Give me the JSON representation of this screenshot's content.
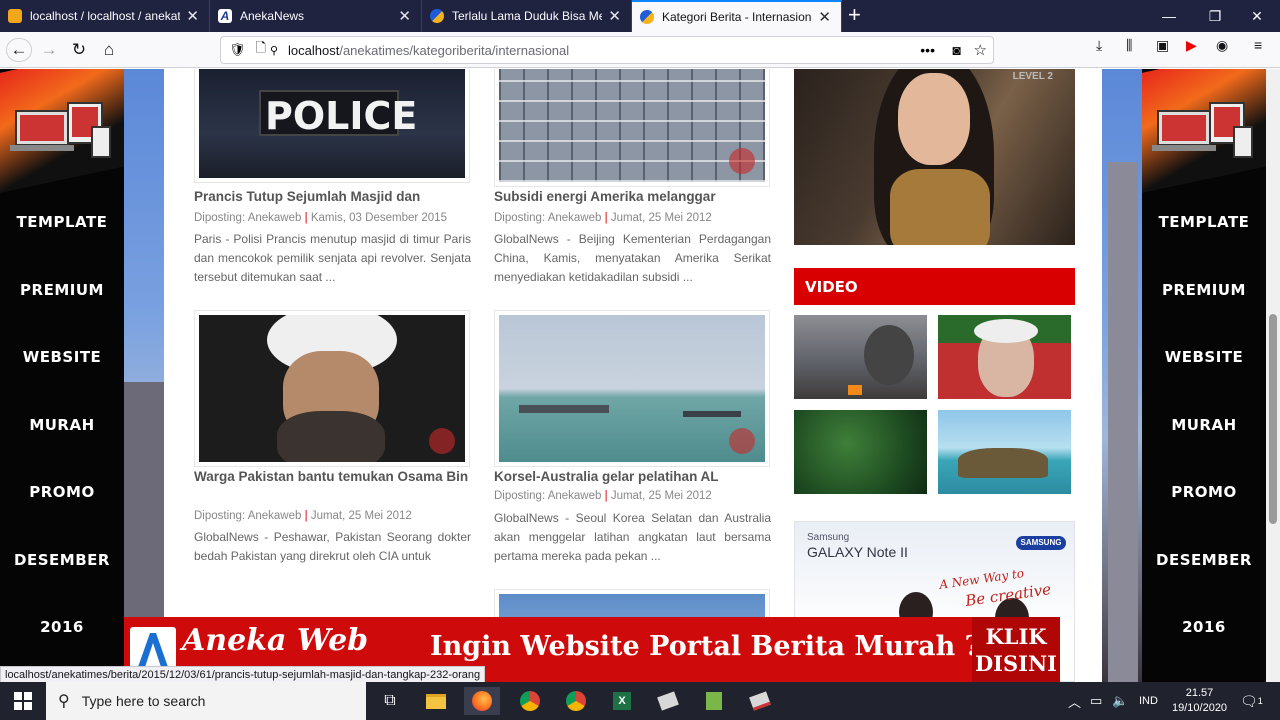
{
  "browser": {
    "tabs": [
      {
        "title": "localhost / localhost / anekatim",
        "active": false
      },
      {
        "title": "AnekaNews",
        "active": false
      },
      {
        "title": "Terlalu Lama Duduk Bisa Menyebab",
        "active": false
      },
      {
        "title": "Kategori Berita - Internasional",
        "active": true
      }
    ],
    "url_host": "localhost",
    "url_path": "/anekatimes/kategoriberita/internasional",
    "status_link": "localhost/anekatimes/berita/2015/12/03/61/prancis-tutup-sejumlah-masjid-dan-tangkap-232-orang"
  },
  "side_banner": {
    "words": [
      "TEMPLATE",
      "PREMIUM",
      "WEBSITE",
      "MURAH",
      "PROMO",
      "DESEMBER",
      "2016"
    ]
  },
  "posts": [
    {
      "title": "Prancis Tutup Sejumlah Masjid dan",
      "author": "Diposting: Anekaweb",
      "date": "Kamis, 03 Desember 2015",
      "excerpt": "Paris - Polisi Prancis menutup masjid di timur Paris dan mencokok pemilik senjata api revolver. Senjata tersebut ditemukan saat ..."
    },
    {
      "title": "Subsidi energi Amerika melanggar",
      "author": "Diposting: Anekaweb",
      "date": "Jumat, 25 Mei 2012",
      "excerpt": "GlobalNews - Beijing Kementerian Perdagangan China, Kamis, menyatakan Amerika Serikat menyediakan ketidakadilan subsidi ..."
    },
    {
      "title": "Warga Pakistan bantu temukan Osama Bin",
      "author": "Diposting: Anekaweb",
      "date": "Jumat, 25 Mei 2012",
      "excerpt": "GlobalNews - Peshawar, Pakistan Seorang dokter bedah Pakistan yang direkrut oleh CIA untuk"
    },
    {
      "title": "Korsel-Australia gelar pelatihan AL",
      "author": "Diposting: Anekaweb",
      "date": "Jumat, 25 Mei 2012",
      "excerpt": "GlobalNews - Seoul  Korea Selatan dan Australia akan menggelar latihan angkatan laut bersama pertama mereka pada pekan ..."
    }
  ],
  "police_text": "POLICE",
  "sidebar": {
    "ad_level": "LEVEL 2",
    "video_heading": "VIDEO",
    "samsung_brand": "Samsung",
    "samsung_model": "GALAXY Note II",
    "samsung_logo": "SAMSUNG",
    "samsung_tagline_1": "A New Way to",
    "samsung_tagline_2": "Be creative"
  },
  "promo": {
    "logo_text": "Aneka Web",
    "slogan": "Ingin Website Portal Berita Murah ?",
    "cta_line1": "KLIK",
    "cta_line2": "DISINI"
  },
  "taskbar": {
    "search_placeholder": "Type here to search",
    "lang": "IND",
    "time": "21.57",
    "date": "19/10/2020",
    "notif_count": "1"
  },
  "colors": {
    "accent_red": "#d80000",
    "tab_bar": "#202340",
    "taskbar": "#20222e"
  }
}
